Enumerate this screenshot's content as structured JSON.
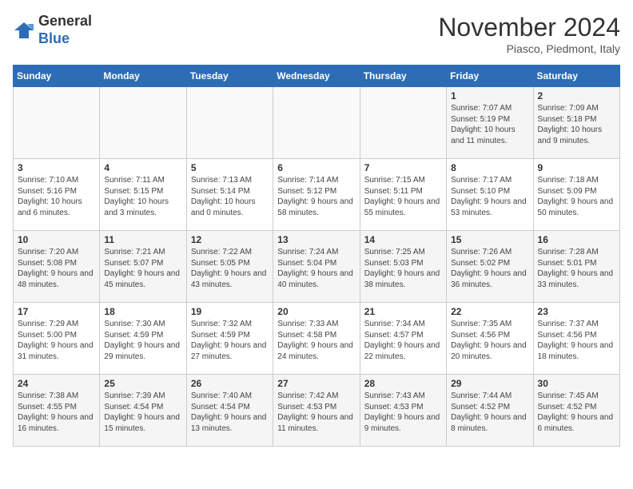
{
  "logo": {
    "line1": "General",
    "line2": "Blue"
  },
  "title": "November 2024",
  "subtitle": "Piasco, Piedmont, Italy",
  "days_of_week": [
    "Sunday",
    "Monday",
    "Tuesday",
    "Wednesday",
    "Thursday",
    "Friday",
    "Saturday"
  ],
  "weeks": [
    [
      {
        "day": "",
        "info": ""
      },
      {
        "day": "",
        "info": ""
      },
      {
        "day": "",
        "info": ""
      },
      {
        "day": "",
        "info": ""
      },
      {
        "day": "",
        "info": ""
      },
      {
        "day": "1",
        "info": "Sunrise: 7:07 AM\nSunset: 5:19 PM\nDaylight: 10 hours and 11 minutes."
      },
      {
        "day": "2",
        "info": "Sunrise: 7:09 AM\nSunset: 5:18 PM\nDaylight: 10 hours and 9 minutes."
      }
    ],
    [
      {
        "day": "3",
        "info": "Sunrise: 7:10 AM\nSunset: 5:16 PM\nDaylight: 10 hours and 6 minutes."
      },
      {
        "day": "4",
        "info": "Sunrise: 7:11 AM\nSunset: 5:15 PM\nDaylight: 10 hours and 3 minutes."
      },
      {
        "day": "5",
        "info": "Sunrise: 7:13 AM\nSunset: 5:14 PM\nDaylight: 10 hours and 0 minutes."
      },
      {
        "day": "6",
        "info": "Sunrise: 7:14 AM\nSunset: 5:12 PM\nDaylight: 9 hours and 58 minutes."
      },
      {
        "day": "7",
        "info": "Sunrise: 7:15 AM\nSunset: 5:11 PM\nDaylight: 9 hours and 55 minutes."
      },
      {
        "day": "8",
        "info": "Sunrise: 7:17 AM\nSunset: 5:10 PM\nDaylight: 9 hours and 53 minutes."
      },
      {
        "day": "9",
        "info": "Sunrise: 7:18 AM\nSunset: 5:09 PM\nDaylight: 9 hours and 50 minutes."
      }
    ],
    [
      {
        "day": "10",
        "info": "Sunrise: 7:20 AM\nSunset: 5:08 PM\nDaylight: 9 hours and 48 minutes."
      },
      {
        "day": "11",
        "info": "Sunrise: 7:21 AM\nSunset: 5:07 PM\nDaylight: 9 hours and 45 minutes."
      },
      {
        "day": "12",
        "info": "Sunrise: 7:22 AM\nSunset: 5:05 PM\nDaylight: 9 hours and 43 minutes."
      },
      {
        "day": "13",
        "info": "Sunrise: 7:24 AM\nSunset: 5:04 PM\nDaylight: 9 hours and 40 minutes."
      },
      {
        "day": "14",
        "info": "Sunrise: 7:25 AM\nSunset: 5:03 PM\nDaylight: 9 hours and 38 minutes."
      },
      {
        "day": "15",
        "info": "Sunrise: 7:26 AM\nSunset: 5:02 PM\nDaylight: 9 hours and 36 minutes."
      },
      {
        "day": "16",
        "info": "Sunrise: 7:28 AM\nSunset: 5:01 PM\nDaylight: 9 hours and 33 minutes."
      }
    ],
    [
      {
        "day": "17",
        "info": "Sunrise: 7:29 AM\nSunset: 5:00 PM\nDaylight: 9 hours and 31 minutes."
      },
      {
        "day": "18",
        "info": "Sunrise: 7:30 AM\nSunset: 4:59 PM\nDaylight: 9 hours and 29 minutes."
      },
      {
        "day": "19",
        "info": "Sunrise: 7:32 AM\nSunset: 4:59 PM\nDaylight: 9 hours and 27 minutes."
      },
      {
        "day": "20",
        "info": "Sunrise: 7:33 AM\nSunset: 4:58 PM\nDaylight: 9 hours and 24 minutes."
      },
      {
        "day": "21",
        "info": "Sunrise: 7:34 AM\nSunset: 4:57 PM\nDaylight: 9 hours and 22 minutes."
      },
      {
        "day": "22",
        "info": "Sunrise: 7:35 AM\nSunset: 4:56 PM\nDaylight: 9 hours and 20 minutes."
      },
      {
        "day": "23",
        "info": "Sunrise: 7:37 AM\nSunset: 4:56 PM\nDaylight: 9 hours and 18 minutes."
      }
    ],
    [
      {
        "day": "24",
        "info": "Sunrise: 7:38 AM\nSunset: 4:55 PM\nDaylight: 9 hours and 16 minutes."
      },
      {
        "day": "25",
        "info": "Sunrise: 7:39 AM\nSunset: 4:54 PM\nDaylight: 9 hours and 15 minutes."
      },
      {
        "day": "26",
        "info": "Sunrise: 7:40 AM\nSunset: 4:54 PM\nDaylight: 9 hours and 13 minutes."
      },
      {
        "day": "27",
        "info": "Sunrise: 7:42 AM\nSunset: 4:53 PM\nDaylight: 9 hours and 11 minutes."
      },
      {
        "day": "28",
        "info": "Sunrise: 7:43 AM\nSunset: 4:53 PM\nDaylight: 9 hours and 9 minutes."
      },
      {
        "day": "29",
        "info": "Sunrise: 7:44 AM\nSunset: 4:52 PM\nDaylight: 9 hours and 8 minutes."
      },
      {
        "day": "30",
        "info": "Sunrise: 7:45 AM\nSunset: 4:52 PM\nDaylight: 9 hours and 6 minutes."
      }
    ]
  ]
}
